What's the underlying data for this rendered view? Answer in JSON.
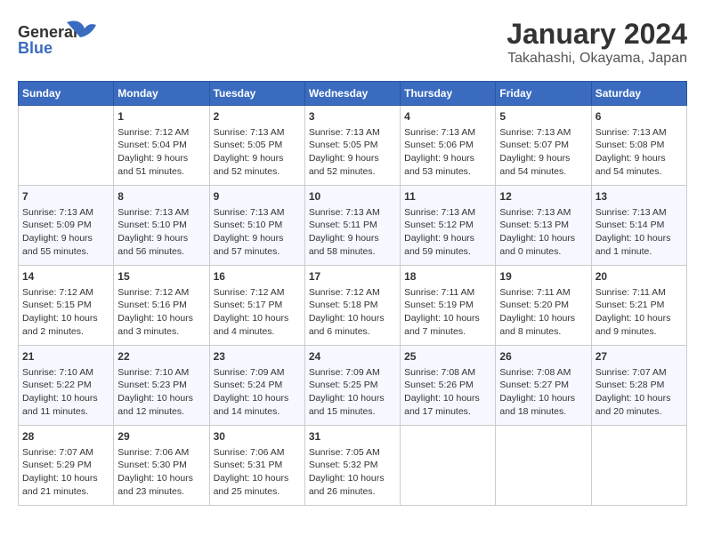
{
  "header": {
    "logo_general": "General",
    "logo_blue": "Blue",
    "month": "January 2024",
    "location": "Takahashi, Okayama, Japan"
  },
  "weekdays": [
    "Sunday",
    "Monday",
    "Tuesday",
    "Wednesday",
    "Thursday",
    "Friday",
    "Saturday"
  ],
  "weeks": [
    [
      {
        "day": "",
        "info": ""
      },
      {
        "day": "1",
        "info": "Sunrise: 7:12 AM\nSunset: 5:04 PM\nDaylight: 9 hours\nand 51 minutes."
      },
      {
        "day": "2",
        "info": "Sunrise: 7:13 AM\nSunset: 5:05 PM\nDaylight: 9 hours\nand 52 minutes."
      },
      {
        "day": "3",
        "info": "Sunrise: 7:13 AM\nSunset: 5:05 PM\nDaylight: 9 hours\nand 52 minutes."
      },
      {
        "day": "4",
        "info": "Sunrise: 7:13 AM\nSunset: 5:06 PM\nDaylight: 9 hours\nand 53 minutes."
      },
      {
        "day": "5",
        "info": "Sunrise: 7:13 AM\nSunset: 5:07 PM\nDaylight: 9 hours\nand 54 minutes."
      },
      {
        "day": "6",
        "info": "Sunrise: 7:13 AM\nSunset: 5:08 PM\nDaylight: 9 hours\nand 54 minutes."
      }
    ],
    [
      {
        "day": "7",
        "info": "Sunrise: 7:13 AM\nSunset: 5:09 PM\nDaylight: 9 hours\nand 55 minutes."
      },
      {
        "day": "8",
        "info": "Sunrise: 7:13 AM\nSunset: 5:10 PM\nDaylight: 9 hours\nand 56 minutes."
      },
      {
        "day": "9",
        "info": "Sunrise: 7:13 AM\nSunset: 5:10 PM\nDaylight: 9 hours\nand 57 minutes."
      },
      {
        "day": "10",
        "info": "Sunrise: 7:13 AM\nSunset: 5:11 PM\nDaylight: 9 hours\nand 58 minutes."
      },
      {
        "day": "11",
        "info": "Sunrise: 7:13 AM\nSunset: 5:12 PM\nDaylight: 9 hours\nand 59 minutes."
      },
      {
        "day": "12",
        "info": "Sunrise: 7:13 AM\nSunset: 5:13 PM\nDaylight: 10 hours\nand 0 minutes."
      },
      {
        "day": "13",
        "info": "Sunrise: 7:13 AM\nSunset: 5:14 PM\nDaylight: 10 hours\nand 1 minute."
      }
    ],
    [
      {
        "day": "14",
        "info": "Sunrise: 7:12 AM\nSunset: 5:15 PM\nDaylight: 10 hours\nand 2 minutes."
      },
      {
        "day": "15",
        "info": "Sunrise: 7:12 AM\nSunset: 5:16 PM\nDaylight: 10 hours\nand 3 minutes."
      },
      {
        "day": "16",
        "info": "Sunrise: 7:12 AM\nSunset: 5:17 PM\nDaylight: 10 hours\nand 4 minutes."
      },
      {
        "day": "17",
        "info": "Sunrise: 7:12 AM\nSunset: 5:18 PM\nDaylight: 10 hours\nand 6 minutes."
      },
      {
        "day": "18",
        "info": "Sunrise: 7:11 AM\nSunset: 5:19 PM\nDaylight: 10 hours\nand 7 minutes."
      },
      {
        "day": "19",
        "info": "Sunrise: 7:11 AM\nSunset: 5:20 PM\nDaylight: 10 hours\nand 8 minutes."
      },
      {
        "day": "20",
        "info": "Sunrise: 7:11 AM\nSunset: 5:21 PM\nDaylight: 10 hours\nand 9 minutes."
      }
    ],
    [
      {
        "day": "21",
        "info": "Sunrise: 7:10 AM\nSunset: 5:22 PM\nDaylight: 10 hours\nand 11 minutes."
      },
      {
        "day": "22",
        "info": "Sunrise: 7:10 AM\nSunset: 5:23 PM\nDaylight: 10 hours\nand 12 minutes."
      },
      {
        "day": "23",
        "info": "Sunrise: 7:09 AM\nSunset: 5:24 PM\nDaylight: 10 hours\nand 14 minutes."
      },
      {
        "day": "24",
        "info": "Sunrise: 7:09 AM\nSunset: 5:25 PM\nDaylight: 10 hours\nand 15 minutes."
      },
      {
        "day": "25",
        "info": "Sunrise: 7:08 AM\nSunset: 5:26 PM\nDaylight: 10 hours\nand 17 minutes."
      },
      {
        "day": "26",
        "info": "Sunrise: 7:08 AM\nSunset: 5:27 PM\nDaylight: 10 hours\nand 18 minutes."
      },
      {
        "day": "27",
        "info": "Sunrise: 7:07 AM\nSunset: 5:28 PM\nDaylight: 10 hours\nand 20 minutes."
      }
    ],
    [
      {
        "day": "28",
        "info": "Sunrise: 7:07 AM\nSunset: 5:29 PM\nDaylight: 10 hours\nand 21 minutes."
      },
      {
        "day": "29",
        "info": "Sunrise: 7:06 AM\nSunset: 5:30 PM\nDaylight: 10 hours\nand 23 minutes."
      },
      {
        "day": "30",
        "info": "Sunrise: 7:06 AM\nSunset: 5:31 PM\nDaylight: 10 hours\nand 25 minutes."
      },
      {
        "day": "31",
        "info": "Sunrise: 7:05 AM\nSunset: 5:32 PM\nDaylight: 10 hours\nand 26 minutes."
      },
      {
        "day": "",
        "info": ""
      },
      {
        "day": "",
        "info": ""
      },
      {
        "day": "",
        "info": ""
      }
    ]
  ]
}
